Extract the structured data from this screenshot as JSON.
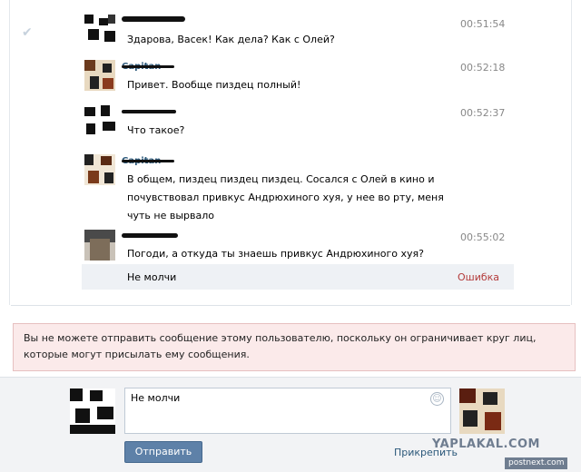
{
  "messages": [
    {
      "author": "",
      "text": "Здарова, Васек! Как дела? Как с Олей?",
      "time": "00:51:54",
      "read_mark": "check-icon"
    },
    {
      "author": "Capitan",
      "text": "Привет. Вообще пиздец полный!",
      "time": "00:52:18"
    },
    {
      "author": "",
      "text": "Что такое?",
      "time": "00:52:37"
    },
    {
      "author": "Capitan",
      "text": "В общем, пиздец пиздец пиздец. Сосался с Олей в кино и почувствовал привкус Андрюхиного хуя, у нее во рту, меня чуть не вырвало",
      "time": ""
    },
    {
      "author": "",
      "text": "Погоди, а откуда ты знаешь привкус Андрюхиного хуя?",
      "time": "00:55:02"
    }
  ],
  "pending": {
    "text": "Не молчи",
    "status": "Ошибка"
  },
  "error_notice": "Вы не можете отправить сообщение этому пользователю, поскольку он ограничивает круг лиц, которые могут присылать ему сообщения.",
  "composer": {
    "draft": "Не молчи",
    "send_label": "Отправить",
    "attach_label": "Прикрепить",
    "emoji_icon": "smile-icon"
  },
  "watermark": {
    "brand": "YAPLAKAL.COM",
    "source": "postnext.com"
  },
  "colors": {
    "link": "#2b587a",
    "error": "#b33a3a",
    "button": "#5e81a8",
    "error_bg": "#fbeaea"
  }
}
